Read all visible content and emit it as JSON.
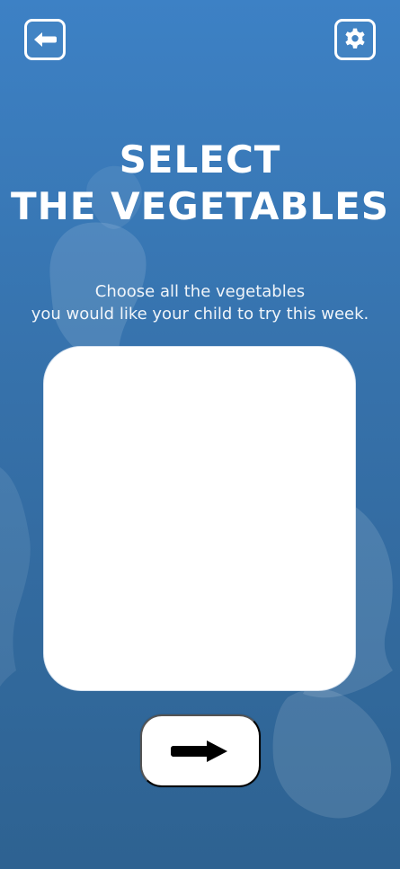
{
  "header": {
    "back_icon": "back-arrow-icon",
    "settings_icon": "gear-icon"
  },
  "page": {
    "title_line1": "SELECT",
    "title_line2": "THE VEGETABLES",
    "subtitle_line1": "Choose all the vegetables",
    "subtitle_line2": "you would like your child to try this week."
  },
  "footer": {
    "next_icon": "right-arrow-icon"
  },
  "colors": {
    "background_top": "#3a7fc4",
    "background_bottom": "#2a5f8f",
    "card": "#ffffff",
    "icon": "#000000"
  }
}
